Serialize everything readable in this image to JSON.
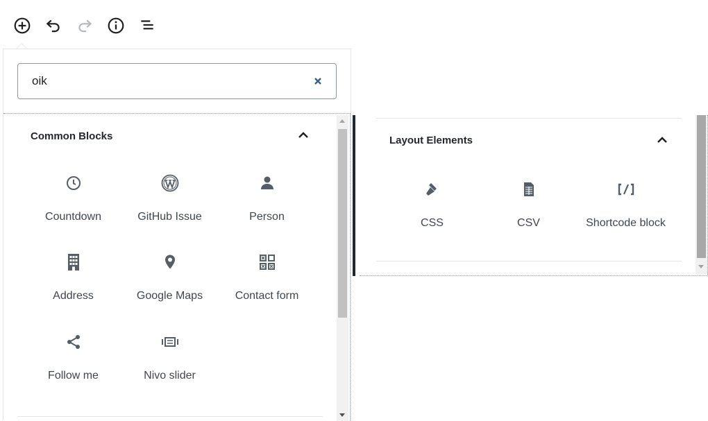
{
  "toolbar": {
    "buttons": [
      {
        "name": "add-block-button",
        "icon": "plus-circle-icon"
      },
      {
        "name": "undo-button",
        "icon": "undo-icon"
      },
      {
        "name": "redo-button",
        "icon": "redo-icon"
      },
      {
        "name": "content-info-button",
        "icon": "info-icon"
      },
      {
        "name": "block-navigation-button",
        "icon": "list-icon"
      }
    ]
  },
  "search": {
    "value": "oik",
    "clear_icon": "close-icon"
  },
  "common": {
    "title": "Common Blocks",
    "blocks": [
      {
        "label": "Countdown",
        "icon": "clock-icon"
      },
      {
        "label": "GitHub Issue",
        "icon": "wordpress-icon"
      },
      {
        "label": "Person",
        "icon": "person-icon"
      },
      {
        "label": "Address",
        "icon": "building-icon"
      },
      {
        "label": "Google Maps",
        "icon": "location-pin-icon"
      },
      {
        "label": "Contact form",
        "icon": "forms-icon"
      },
      {
        "label": "Follow me",
        "icon": "share-icon"
      },
      {
        "label": "Nivo slider",
        "icon": "slides-icon"
      }
    ]
  },
  "layout": {
    "title": "Layout Elements",
    "blocks": [
      {
        "label": "CSS",
        "icon": "hammer-icon"
      },
      {
        "label": "CSV",
        "icon": "media-spreadsheet-icon"
      },
      {
        "label": "Shortcode block",
        "icon": "shortcode-icon"
      }
    ]
  },
  "colors": {
    "icon": "#555d66",
    "text": "#40464d",
    "clear": "#3a5f8a"
  }
}
